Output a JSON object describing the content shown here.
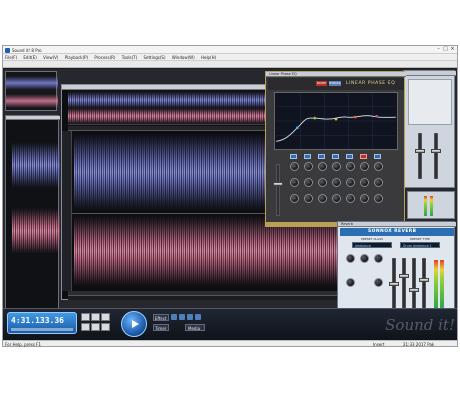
{
  "app": {
    "title": "Sound it! 8 Pro",
    "menus": [
      "File(F)",
      "Edit(E)",
      "View(V)",
      "Playback(P)",
      "Process(R)",
      "Tools(T)",
      "Settings(S)",
      "Window(W)",
      "Help(H)"
    ],
    "window_controls": [
      "–",
      "□",
      "×"
    ]
  },
  "eq": {
    "window_title": "Linear Phase EQ",
    "brand": "LINEAR PHASE EQ",
    "btn_a": "MODE",
    "btn_b": "BYPASS",
    "preset_value": "A  ·  B"
  },
  "reverb": {
    "window_title": "Reverb",
    "brand": "SONNOX REVERB",
    "preset_class_label": "PRESET CLASS",
    "preset_class_value": "Ambience",
    "preset_type_label": "PRESET TYPE",
    "preset_type_value": "Drum Ambience 1"
  },
  "transport": {
    "time": "4:31.133.36",
    "effect_label": "Effect",
    "timer_label": "Timer",
    "media_label": "Media"
  },
  "watermark": "Sound it!",
  "statusbar": {
    "left": "For Help, press F1",
    "right_a": "Insert",
    "right_b": "21:33 2017 Pak"
  },
  "colors": {
    "waveform_top": "#6d73c2",
    "waveform_bottom": "#c56a86",
    "eq_accent": "#c8b060",
    "reverb_accent": "#2a6fb4",
    "transport_lcd": "#2f86d8"
  }
}
